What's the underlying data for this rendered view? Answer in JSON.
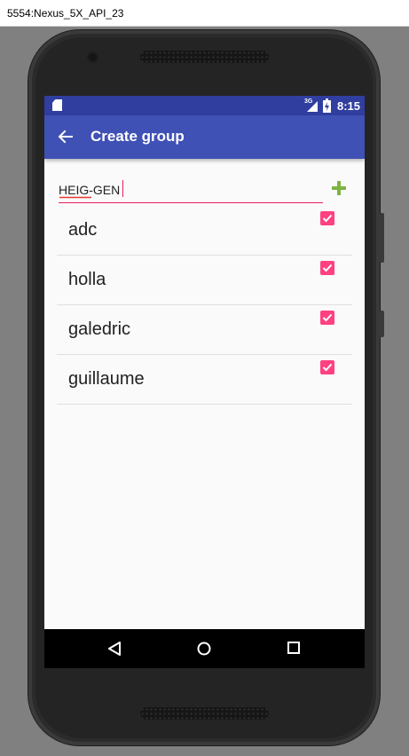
{
  "window": {
    "title": "5554:Nexus_5X_API_23"
  },
  "status_bar": {
    "network": "3G",
    "time": "8:15"
  },
  "app_bar": {
    "title": "Create group"
  },
  "group_form": {
    "name_value": "HEIG-GEN"
  },
  "users": [
    {
      "name": "adc",
      "checked": true
    },
    {
      "name": "holla",
      "checked": true
    },
    {
      "name": "galedric",
      "checked": true
    },
    {
      "name": "guillaume",
      "checked": true
    }
  ],
  "colors": {
    "primary": "#3f51b5",
    "primary_dark": "#303f9f",
    "accent": "#ff4081",
    "add_icon": "#7cb342"
  },
  "icons": {
    "back": "arrow-left-icon",
    "add": "plus-icon",
    "checkbox": "checkbox-checked-icon",
    "nav": [
      "triangle-back-icon",
      "circle-home-icon",
      "square-recents-icon"
    ]
  }
}
